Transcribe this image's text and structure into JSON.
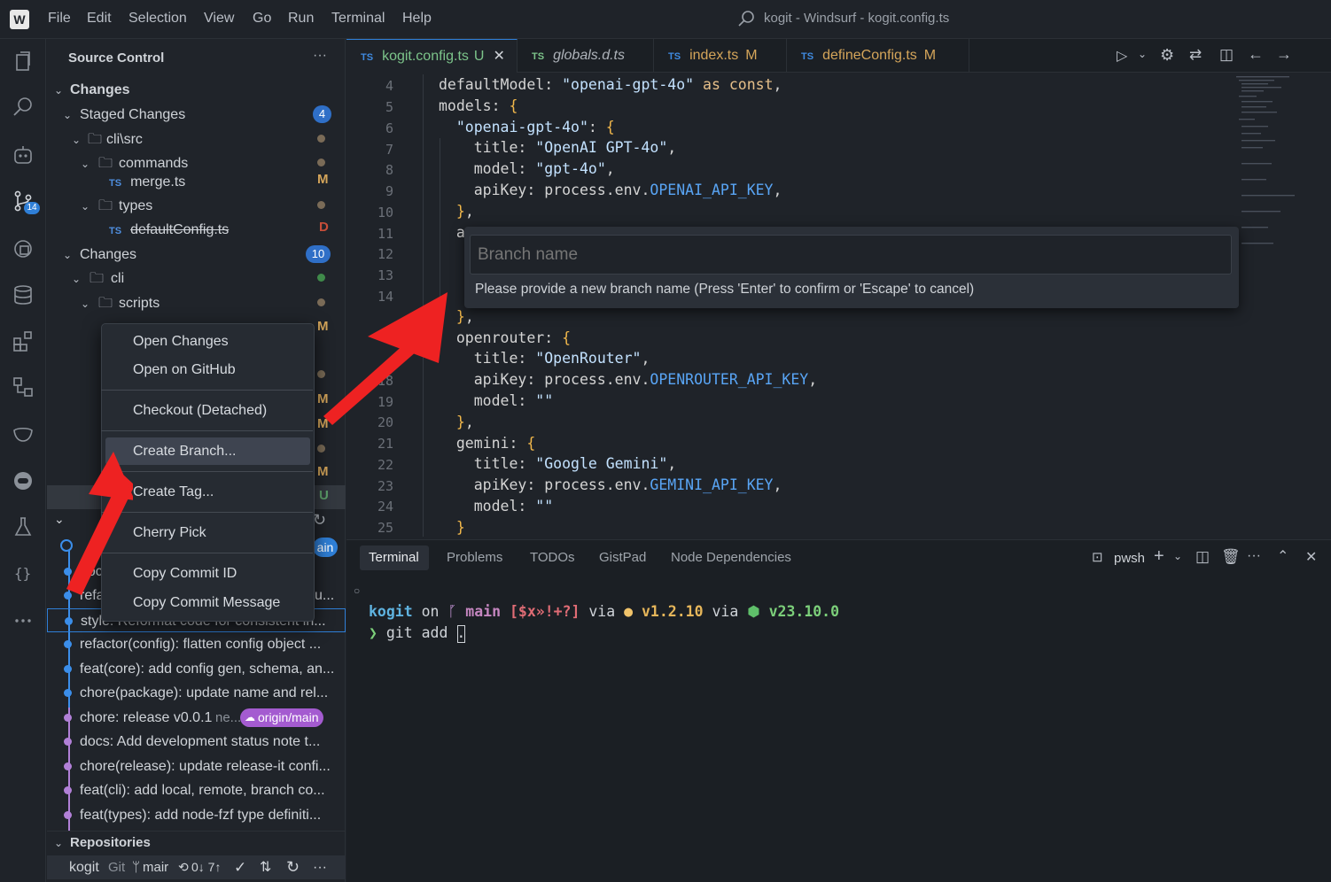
{
  "app": {
    "window_title": "kogit - Windsurf - kogit.config.ts"
  },
  "menu": [
    "File",
    "Edit",
    "Selection",
    "View",
    "Go",
    "Run",
    "Terminal",
    "Help"
  ],
  "activity": {
    "scm_badge": "14"
  },
  "sidebar": {
    "title": "Source Control",
    "changes_header": "Changes",
    "staged": {
      "label": "Staged Changes",
      "count": "4"
    },
    "staged_tree": [
      {
        "label": "cli\\src",
        "status": ""
      },
      {
        "label": "commands",
        "status": ""
      },
      {
        "label": "merge.ts",
        "status": "M"
      },
      {
        "label": "types",
        "status": ""
      },
      {
        "label": "defaultConfig.ts",
        "status": "D"
      }
    ],
    "changes": {
      "label": "Changes",
      "count": "10"
    },
    "changes_tree": [
      {
        "label": "cli",
        "status": ""
      },
      {
        "label": "scripts",
        "status": ""
      }
    ],
    "graph": [
      {
        "text": "doc",
        "color": "#3b8eea"
      },
      {
        "text": "refa",
        "color": "#3b8eea"
      },
      {
        "text": "style: Reformat code for consistent in...",
        "color": "#3b8eea"
      },
      {
        "text": "refactor(config): flatten config object ...",
        "color": "#3b8eea"
      },
      {
        "text": "feat(core): add config gen, schema, an...",
        "color": "#3b8eea"
      },
      {
        "text": "chore(package): update name and rel...",
        "color": "#3b8eea"
      },
      {
        "text": "chore: release v0.0.1",
        "color": "#b180d7"
      },
      {
        "text": "docs: Add development status note t...",
        "color": "#b180d7"
      },
      {
        "text": "chore(release): update release-it confi...",
        "color": "#b180d7"
      },
      {
        "text": "feat(cli): add local, remote, branch co...",
        "color": "#b180d7"
      },
      {
        "text": "feat(types): add node-fzf type definiti...",
        "color": "#b180d7"
      }
    ],
    "graph_extra": {
      "ne": "ne...",
      "remote_badge": "origin/main",
      "main_badge": "ain",
      "trailing": "u..."
    },
    "repositories": {
      "header": "Repositories",
      "name": "kogit",
      "kind": "Git",
      "branch": "mair",
      "sync": "0↓ 7↑"
    }
  },
  "editor": {
    "tabs": [
      {
        "label": "kogit.config.ts",
        "status": "U",
        "active": true
      },
      {
        "label": "globals.d.ts",
        "status": "",
        "active": false
      },
      {
        "label": "index.ts",
        "status": "M",
        "active": false
      },
      {
        "label": "defineConfig.ts",
        "status": "M",
        "active": false
      }
    ],
    "line_numbers": [
      "4",
      "5",
      "6",
      "7",
      "8",
      "9",
      "10",
      "11",
      "12",
      "13",
      "14",
      "",
      "",
      "18",
      "19",
      "20",
      "21",
      "22",
      "23",
      "24",
      "25"
    ]
  },
  "branch_prompt": {
    "placeholder": "Branch name",
    "hint": "Please provide a new branch name (Press 'Enter' to confirm or 'Escape' to cancel)"
  },
  "context_menu": {
    "items": [
      "Open Changes",
      "Open on GitHub",
      "Checkout (Detached)",
      "Create Branch...",
      "Create Tag...",
      "Cherry Pick",
      "Copy Commit ID",
      "Copy Commit Message"
    ]
  },
  "panel": {
    "tabs": [
      "Terminal",
      "Problems",
      "TODOs",
      "GistPad",
      "Node Dependencies"
    ],
    "shell": "pwsh",
    "prompt": {
      "dir": "kogit",
      "on": "on",
      "branch": "main",
      "status": "[$x»!+?]",
      "via1": "via",
      "bun": "v1.2.10",
      "via2": "via",
      "node": "v23.10.0"
    },
    "command": "git add ."
  }
}
